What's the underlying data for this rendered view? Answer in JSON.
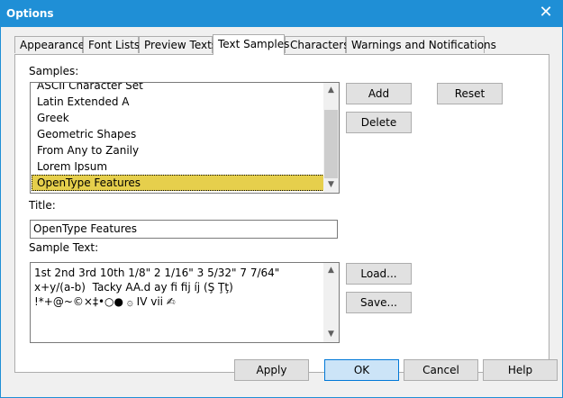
{
  "window": {
    "title": "Options",
    "close_glyph": "✕"
  },
  "tabs": [
    {
      "label": "Appearance",
      "active": false
    },
    {
      "label": "Font Lists",
      "active": false
    },
    {
      "label": "Preview Texts",
      "active": false
    },
    {
      "label": "Text Samples",
      "active": true
    },
    {
      "label": "Characters",
      "active": false
    },
    {
      "label": "Warnings and Notifications",
      "active": false
    }
  ],
  "samples": {
    "label": "Samples:",
    "items": [
      "ASCII Character Set",
      "Latin Extended A",
      "Greek",
      "Geometric Shapes",
      "From Any to Zanily",
      "Lorem Ipsum",
      "OpenType Features"
    ],
    "selected": "OpenType Features"
  },
  "title_field": {
    "label": "Title:",
    "value": "OpenType Features"
  },
  "sample_text": {
    "label": "Sample Text:",
    "value": "1st 2nd 3rd 10th 1/8\" 2 1/16\" 3 5/32\" 7 7/64\" x+y/(a-b)  Tacky AA.d ay fi fij íj (Ş Ţţ) !*+@~©×‡•○● ۞ IV vii ✍"
  },
  "buttons": {
    "add": "Add",
    "reset": "Reset",
    "delete": "Delete",
    "load": "Load...",
    "save": "Save...",
    "apply": "Apply",
    "ok": "OK",
    "cancel": "Cancel",
    "help": "Help"
  }
}
